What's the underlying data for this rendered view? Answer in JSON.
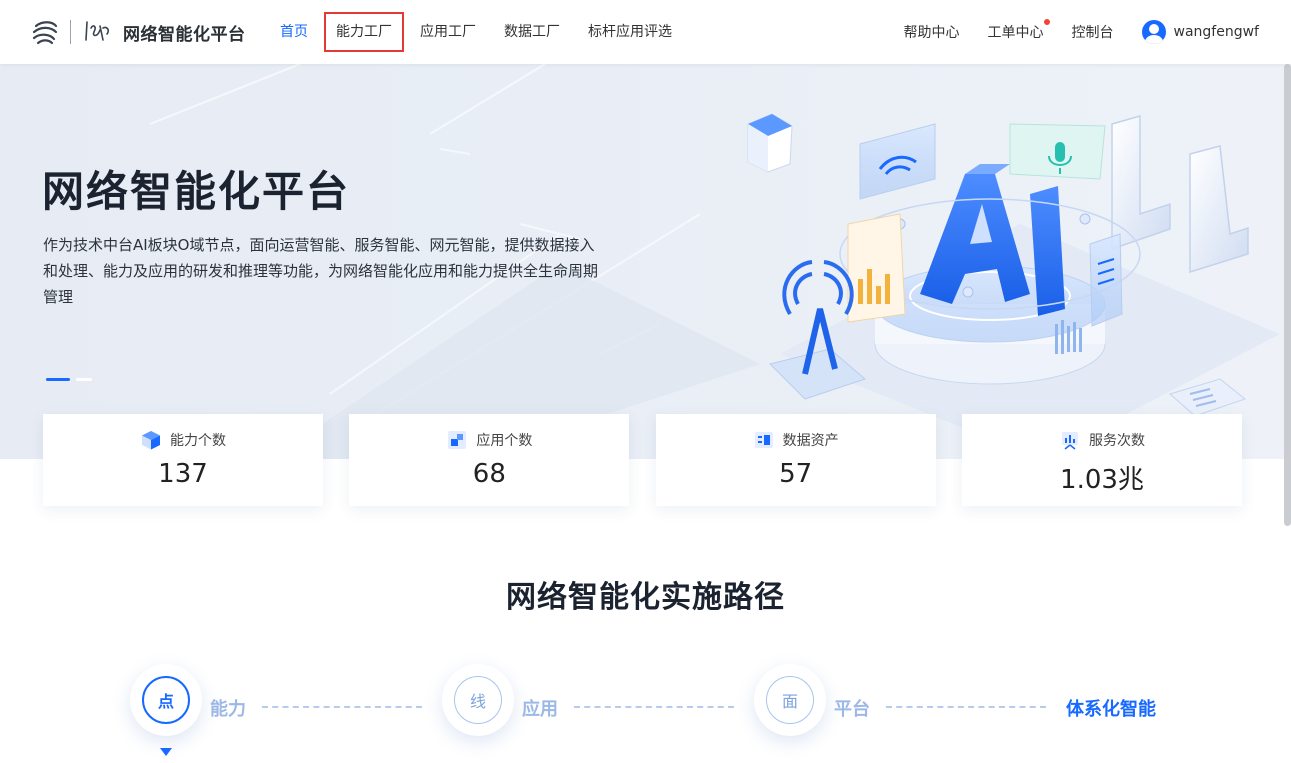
{
  "header": {
    "logo_title": "网络智能化平台",
    "nav": [
      {
        "label": "首页",
        "active": true
      },
      {
        "label": "能力工厂",
        "highlight": true
      },
      {
        "label": "应用工厂"
      },
      {
        "label": "数据工厂"
      },
      {
        "label": "标杆应用评选"
      }
    ],
    "right": {
      "help": "帮助中心",
      "tickets": "工单中心",
      "console": "控制台",
      "username": "wangfengwf"
    }
  },
  "hero": {
    "title": "网络智能化平台",
    "description": "作为技术中台AI板块O域节点，面向运营智能、服务智能、网元智能，提供数据接入和处理、能力及应用的研发和推理等功能，为网络智能化应用和能力提供全生命周期管理",
    "art_text": {
      "ai": "AI",
      "l4": "L4"
    }
  },
  "stats": [
    {
      "label": "能力个数",
      "value": "137",
      "icon": "cube-icon"
    },
    {
      "label": "应用个数",
      "value": "68",
      "icon": "app-blocks-icon"
    },
    {
      "label": "数据资产",
      "value": "57",
      "icon": "data-asset-icon"
    },
    {
      "label": "服务次数",
      "value": "1.03兆",
      "icon": "service-chart-icon"
    }
  ],
  "path": {
    "title": "网络智能化实施路径",
    "steps": [
      {
        "node": "点",
        "label": "能力"
      },
      {
        "node": "线",
        "label": "应用"
      },
      {
        "node": "面",
        "label": "平台"
      }
    ],
    "final": "体系化智能"
  },
  "colors": {
    "accent": "#1769ff",
    "badge": "#f44336",
    "highlight_box": "#e53935"
  }
}
